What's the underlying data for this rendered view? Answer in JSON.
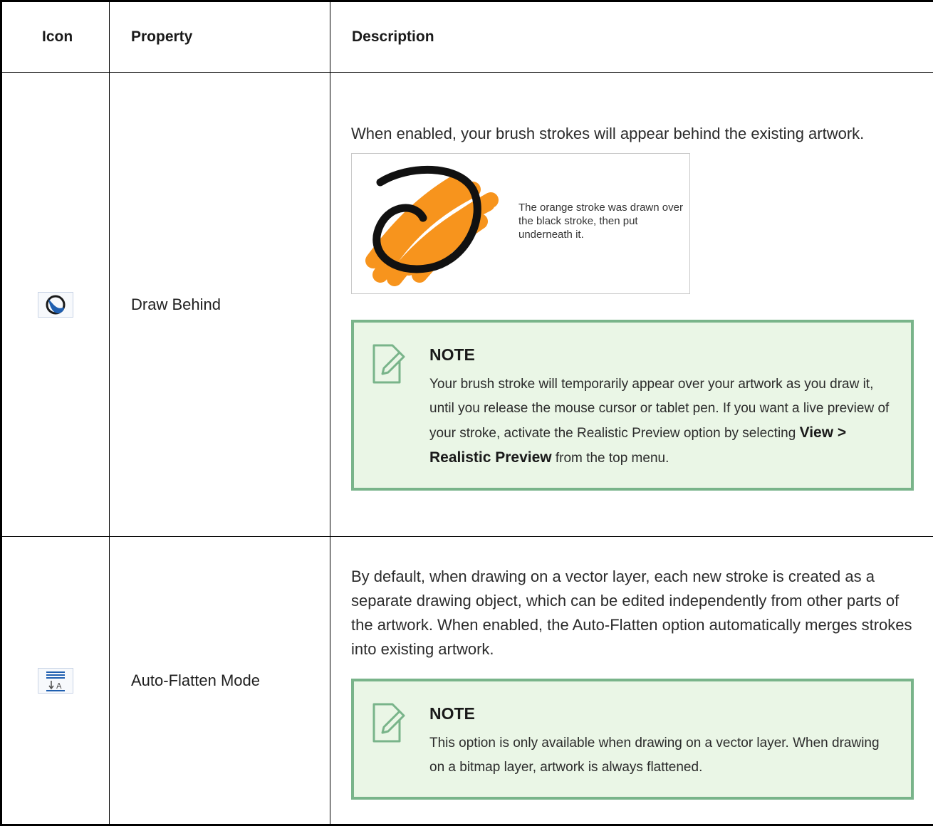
{
  "headers": {
    "icon": "Icon",
    "property": "Property",
    "description": "Description"
  },
  "rows": [
    {
      "icon_name": "draw-behind-icon",
      "property": "Draw Behind",
      "description": "When enabled, your brush strokes will appear behind the existing artwork.",
      "illustration_caption": "The orange stroke was drawn over the black stroke, then put underneath it.",
      "note": {
        "title": "NOTE",
        "text_before": "Your brush stroke will temporarily appear over your artwork as you draw it, until you release the mouse cursor or tablet pen.  If you want a live preview of your stroke, activate the Realistic Preview option by selecting ",
        "bold": "View > Realistic Preview",
        "text_after": " from the top menu."
      }
    },
    {
      "icon_name": "auto-flatten-icon",
      "property": "Auto-Flatten Mode",
      "description": "By default, when drawing on a vector layer, each new stroke is created as a separate drawing object, which can be edited independently from other parts of the artwork. When enabled, the Auto-Flatten option automatically merges strokes into existing artwork.",
      "note": {
        "title": "NOTE",
        "text": "This option is only available when drawing on a vector layer. When drawing on a bitmap layer, artwork is always flattened."
      }
    }
  ],
  "colors": {
    "note_border": "#79b48a",
    "note_background": "#eaf6e6",
    "icon_blue": "#1f5fb0",
    "stroke_orange": "#f7941d"
  }
}
